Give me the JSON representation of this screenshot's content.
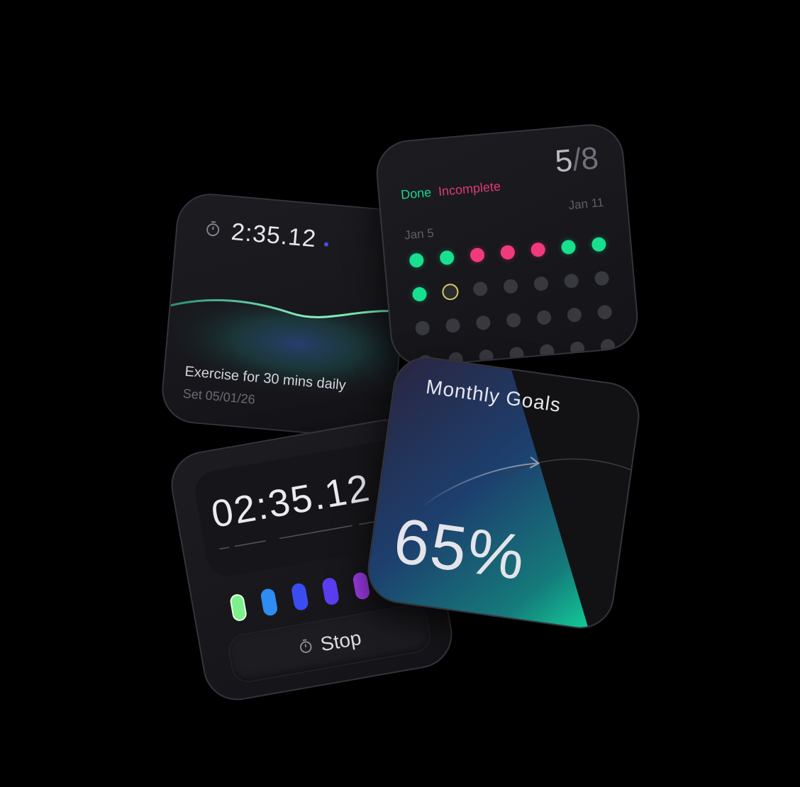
{
  "exercise_card": {
    "timer_icon": "stopwatch-icon",
    "elapsed": "2:35.12",
    "indicator_color": "#4a4df0",
    "goal_title": "Exercise for 30 mins daily",
    "set_date": "Set 05/01/26"
  },
  "streak_card": {
    "legend_done": "Done",
    "legend_incomplete": "Incomplete",
    "completed": "5",
    "separator": "/",
    "total": "8",
    "date_start": "Jan 5",
    "date_end": "Jan 11",
    "colors": {
      "done": "#17e08f",
      "incomplete": "#f03a7d",
      "future": "#38383f",
      "today_ring": "#d7c863"
    },
    "days": [
      "done",
      "done",
      "incomplete",
      "incomplete",
      "incomplete",
      "done",
      "done",
      "done",
      "today",
      "future",
      "future",
      "future",
      "future",
      "future",
      "future",
      "future",
      "future",
      "future",
      "future",
      "future",
      "future",
      "future",
      "future",
      "future",
      "future",
      "future",
      "future",
      "future"
    ]
  },
  "stopwatch_card": {
    "display_time": "02:35.12",
    "lap_colors": [
      "#7cf08a",
      "#2f8cf0",
      "#3b4cf0",
      "#5b3ef0",
      "#a33ef0"
    ],
    "stop_icon": "stopwatch-icon",
    "stop_label": "Stop"
  },
  "goals_card": {
    "title": "Monthly Goals",
    "percent": "65%",
    "progress": 0.65
  }
}
